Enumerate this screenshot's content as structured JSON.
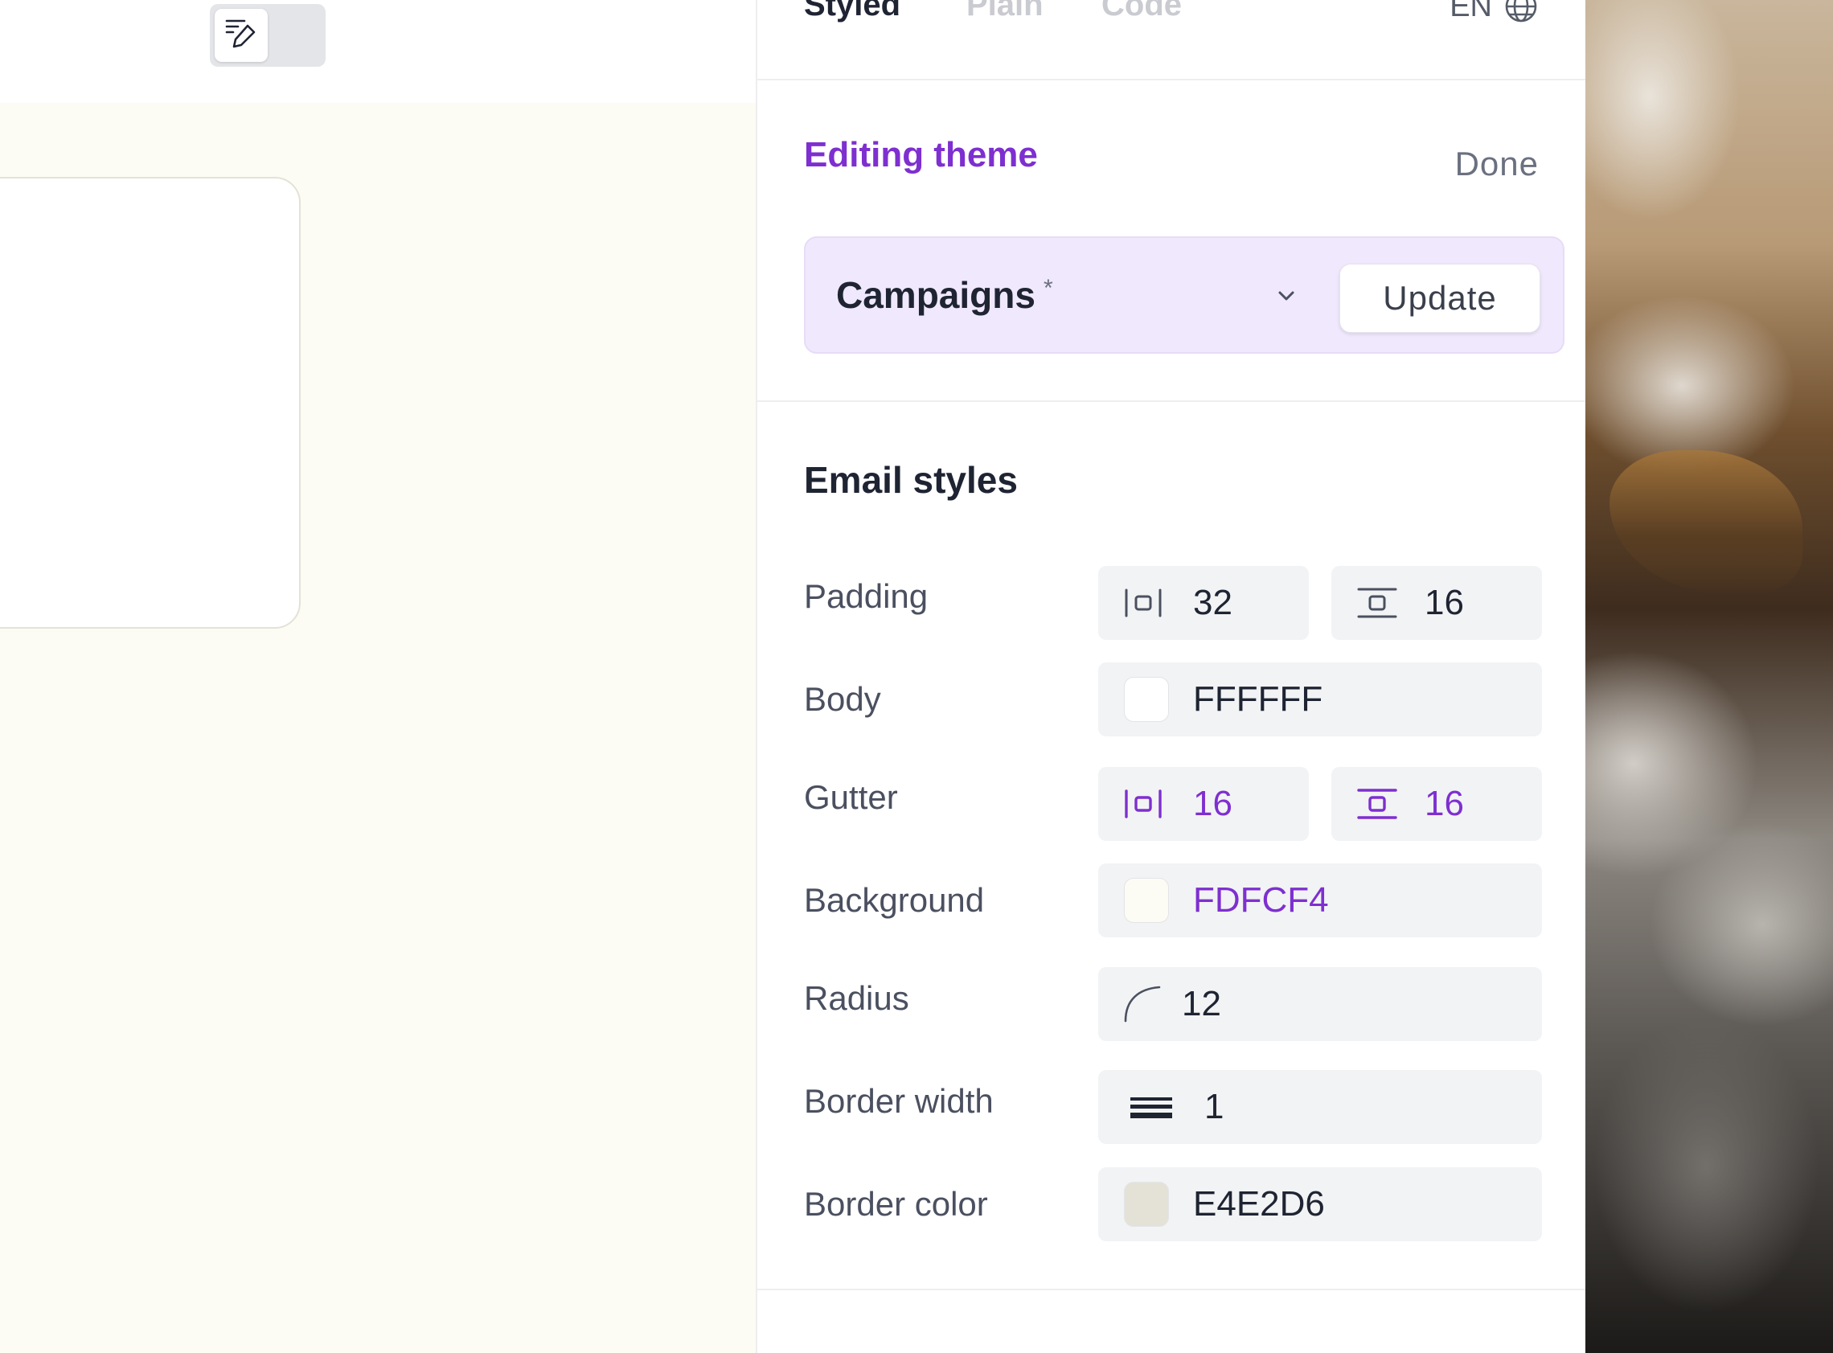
{
  "tabs": [
    {
      "label": "Styled"
    },
    {
      "label": "Plain"
    },
    {
      "label": "Code"
    }
  ],
  "language": {
    "code": "EN",
    "icon": "globe-icon"
  },
  "theme": {
    "heading": "Editing theme",
    "done_label": "Done",
    "name": "Campaigns",
    "modified_marker": "*",
    "update_label": "Update"
  },
  "email_styles": {
    "title": "Email styles",
    "padding": {
      "label": "Padding",
      "horizontal": "32",
      "vertical": "16"
    },
    "body": {
      "label": "Body",
      "color": "FFFFFF"
    },
    "gutter": {
      "label": "Gutter",
      "horizontal": "16",
      "vertical": "16"
    },
    "background": {
      "label": "Background",
      "color": "FDFCF4"
    },
    "radius": {
      "label": "Radius",
      "value": "12"
    },
    "border_width": {
      "label": "Border width",
      "value": "1"
    },
    "border_color": {
      "label": "Border color",
      "color": "E4E2D6"
    }
  },
  "colors": {
    "accent": "#7e2fd0",
    "body_swatch": "#ffffff",
    "background_swatch": "#fdfcf4",
    "border_swatch": "#e4e2d6",
    "canvas": "#fcfcf4"
  },
  "icons": [
    "compose-icon",
    "globe-icon",
    "chevron-down-icon",
    "horizontal-padding-icon",
    "vertical-padding-icon",
    "radius-icon",
    "border-width-icon"
  ]
}
